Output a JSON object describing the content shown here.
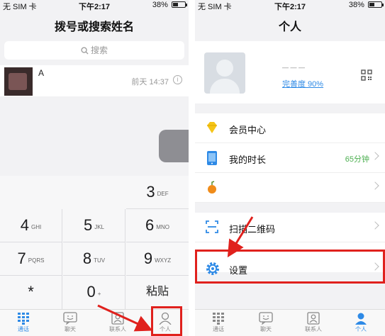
{
  "status_bar": {
    "carrier": "无 SIM 卡",
    "time": "下午2:17",
    "battery": "38%"
  },
  "dialer": {
    "title": "拨号或搜索姓名",
    "search_placeholder": "搜索",
    "recent": {
      "name": "A",
      "time": "前天 14:37"
    },
    "keys": [
      {
        "digit": "3",
        "letters": "DEF"
      },
      {
        "digit": "4",
        "letters": "GHI"
      },
      {
        "digit": "5",
        "letters": "JKL"
      },
      {
        "digit": "6",
        "letters": "MNO"
      },
      {
        "digit": "7",
        "letters": "PQRS"
      },
      {
        "digit": "8",
        "letters": "TUV"
      },
      {
        "digit": "9",
        "letters": "WXYZ"
      },
      {
        "digit": "*",
        "letters": ""
      },
      {
        "digit": "0",
        "letters": "+"
      },
      {
        "digit": "粘贴",
        "letters": ""
      }
    ]
  },
  "tabs": [
    {
      "label": "通话",
      "icon": "dialpad-icon"
    },
    {
      "label": "聊天",
      "icon": "chat-icon"
    },
    {
      "label": "联系人",
      "icon": "contacts-icon"
    },
    {
      "label": "个人",
      "icon": "person-icon"
    }
  ],
  "profile_page": {
    "title": "个人",
    "watermark": "— — —",
    "completion_text": "完善度 90%",
    "menu": [
      {
        "label": "会员中心",
        "value": "",
        "icon": "diamond-icon"
      },
      {
        "label": "我的时长",
        "value": "65分钟",
        "icon": "phone-time-icon"
      },
      {
        "label": "",
        "value": "",
        "icon": "orange-icon"
      },
      {
        "label": "扫描二维码",
        "value": "",
        "icon": "scan-icon"
      },
      {
        "label": "设置",
        "value": "",
        "icon": "gear-icon"
      }
    ]
  },
  "colors": {
    "accent": "#2e8ae6",
    "highlight": "#e0211d",
    "value_green": "#4caf50"
  }
}
